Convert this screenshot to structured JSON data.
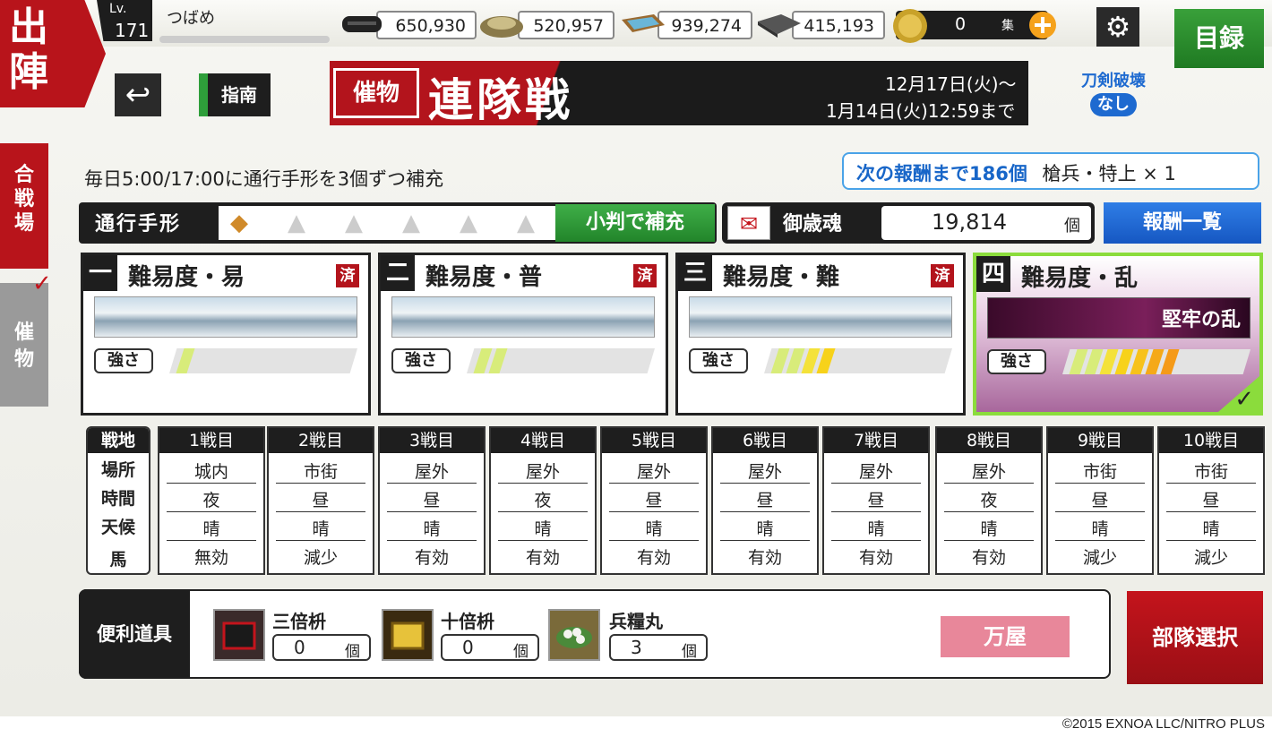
{
  "header": {
    "sortie_label": "出陣",
    "level_prefix": "Lv.",
    "level": "171",
    "player_name": "つばめ",
    "resources": [
      {
        "name": "charcoal-icon",
        "value": "650,930"
      },
      {
        "name": "jade-steel-icon",
        "value": "520,957"
      },
      {
        "name": "cooling-material-icon",
        "value": "939,274"
      },
      {
        "name": "whetstone-icon",
        "value": "415,193"
      }
    ],
    "koban": "0",
    "koban_unit": "集",
    "catalog_label": "目録"
  },
  "subnav": {
    "guide_label": "指南"
  },
  "event": {
    "tag": "催物",
    "title": "連隊戦",
    "period_start": "12月17日(火)～",
    "period_end": "1月14日(火)12:59まで",
    "no_break_line1": "刀剣破壊",
    "no_break_line2": "なし"
  },
  "side_tabs": {
    "battlefield": "合戦場",
    "event": "催物"
  },
  "info": {
    "refill_note": "毎日5:00/17:00に通行手形を3個ずつ補充",
    "next_reward_text": "次の報酬まで186個",
    "next_reward_item": "槍兵・特上 × 1"
  },
  "passes": {
    "label": "通行手形",
    "slots_filled": 1,
    "slots_total": 6,
    "refill_button": "小判で補充"
  },
  "spirit": {
    "label": "御歳魂",
    "value": "19,814",
    "unit": "個",
    "reward_list_button": "報酬一覧"
  },
  "difficulties": [
    {
      "num": "一",
      "title": "難易度・易",
      "done": "済",
      "strength_label": "強さ",
      "strength": 1,
      "selected": false
    },
    {
      "num": "二",
      "title": "難易度・普",
      "done": "済",
      "strength_label": "強さ",
      "strength": 2,
      "selected": false
    },
    {
      "num": "三",
      "title": "難易度・難",
      "done": "済",
      "strength_label": "強さ",
      "strength": 4,
      "selected": false
    },
    {
      "num": "四",
      "title": "難易度・乱",
      "done": "",
      "banner": "堅牢の乱",
      "strength_label": "強さ",
      "strength": 7,
      "selected": true
    }
  ],
  "battle_table": {
    "row_headers": [
      "戦地",
      "場所",
      "時間",
      "天候",
      "馬"
    ],
    "columns": [
      {
        "head": "1戦目",
        "place": "城内",
        "time": "夜",
        "weather": "晴",
        "horse": "無効"
      },
      {
        "head": "2戦目",
        "place": "市街",
        "time": "昼",
        "weather": "晴",
        "horse": "減少"
      },
      {
        "head": "3戦目",
        "place": "屋外",
        "time": "昼",
        "weather": "晴",
        "horse": "有効"
      },
      {
        "head": "4戦目",
        "place": "屋外",
        "time": "夜",
        "weather": "晴",
        "horse": "有効"
      },
      {
        "head": "5戦目",
        "place": "屋外",
        "time": "昼",
        "weather": "晴",
        "horse": "有効"
      },
      {
        "head": "6戦目",
        "place": "屋外",
        "time": "昼",
        "weather": "晴",
        "horse": "有効"
      },
      {
        "head": "7戦目",
        "place": "屋外",
        "time": "昼",
        "weather": "晴",
        "horse": "有効"
      },
      {
        "head": "8戦目",
        "place": "屋外",
        "time": "夜",
        "weather": "晴",
        "horse": "有効"
      },
      {
        "head": "9戦目",
        "place": "市街",
        "time": "昼",
        "weather": "晴",
        "horse": "減少"
      },
      {
        "head": "10戦目",
        "place": "市街",
        "time": "昼",
        "weather": "晴",
        "horse": "減少"
      }
    ]
  },
  "tools": {
    "label": "便利道具",
    "items": [
      {
        "name": "三倍枡",
        "count": "0",
        "unit": "個"
      },
      {
        "name": "十倍枡",
        "count": "0",
        "unit": "個"
      },
      {
        "name": "兵糧丸",
        "count": "3",
        "unit": "個"
      }
    ],
    "shop_button": "万屋"
  },
  "squad_button": "部隊選択",
  "copyright": "©2015 EXNOA LLC/NITRO PLUS"
}
